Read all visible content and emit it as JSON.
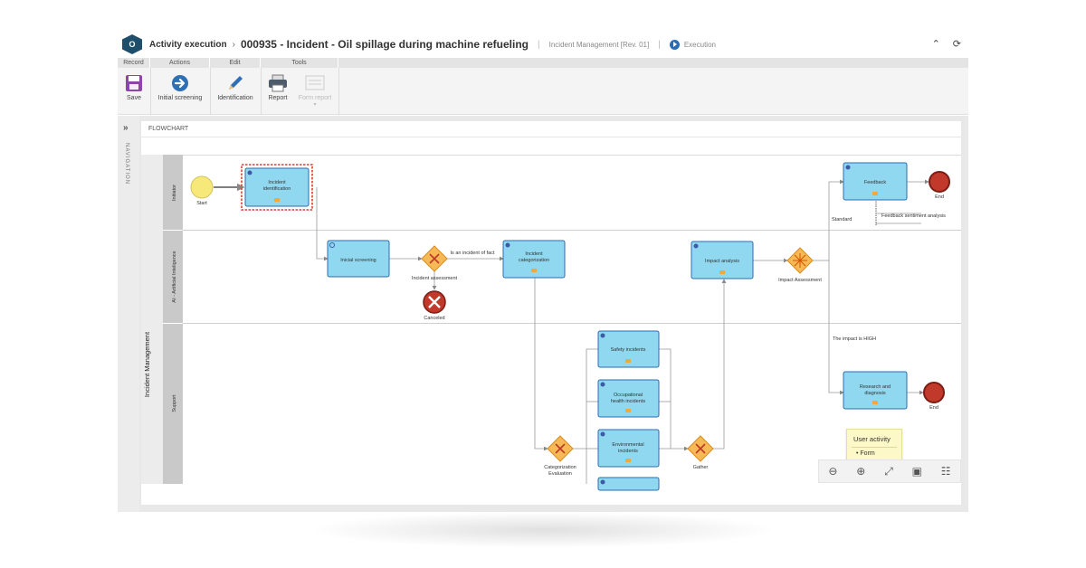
{
  "header": {
    "logo_text": "O",
    "breadcrumb": "Activity execution",
    "breadcrumb_sep": "›",
    "record_title": "000935 - Incident - Oil spillage during machine refueling",
    "process": "Incident Management [Rev. 01]",
    "status": "Execution",
    "collapse_icon": "double-chevron-up-icon",
    "refresh_icon": "refresh-icon"
  },
  "toolbar": {
    "groups": [
      "Record",
      "Actions",
      "Edit",
      "Tools"
    ],
    "save_label": "Save",
    "initial_screening_label": "Initial screening",
    "identification_label": "Identification",
    "report_label": "Report",
    "form_report_label": "Form report"
  },
  "navigation": {
    "toggle": "»",
    "label": "NAVIGATION"
  },
  "flowchart": {
    "title": "FLOWCHART",
    "pool": "Incident Management",
    "lanes": [
      "Initiator",
      "AI - Artificial Inteligence",
      "Support"
    ],
    "events": {
      "start": "Start",
      "end": "End",
      "canceled": "Canceled"
    },
    "tasks": {
      "identification": [
        "Incident",
        "identification"
      ],
      "screening": [
        "Inicial screening"
      ],
      "categorization": [
        "Incident",
        "categorization"
      ],
      "impact": [
        "Impact analysis"
      ],
      "feedback": [
        "Feedback"
      ],
      "safety": [
        "Safety incidents"
      ],
      "occupational": [
        "Occupational",
        "health incidents"
      ],
      "environmental": [
        "Environmental",
        "incidents"
      ],
      "research": [
        "Research and",
        "diagnosis"
      ]
    },
    "gateways": {
      "assessment": "Incident assessment",
      "categorization_eval": [
        "Categorization",
        "Evaluation"
      ],
      "gather": "Gather",
      "impact_assessment": "Impact Assessment"
    },
    "flow_labels": {
      "is_incident": "Is an incident of fact",
      "standard": "Standard",
      "impact_high": "The impact is HIGH",
      "sentiment": "Feedback sentiment analysis"
    },
    "tooltip": {
      "title": "User activity",
      "item": "Form"
    }
  },
  "zoom_controls": [
    "zoom-out-icon",
    "zoom-in-icon",
    "fit-icon",
    "image-icon",
    "tree-icon"
  ],
  "colors": {
    "task_fill": "#8fd8ef",
    "task_stroke": "#2b6cb0",
    "gateway": "#f7b955",
    "end": "#c0392b",
    "start": "#f6e97a",
    "selection": "#e53935"
  }
}
